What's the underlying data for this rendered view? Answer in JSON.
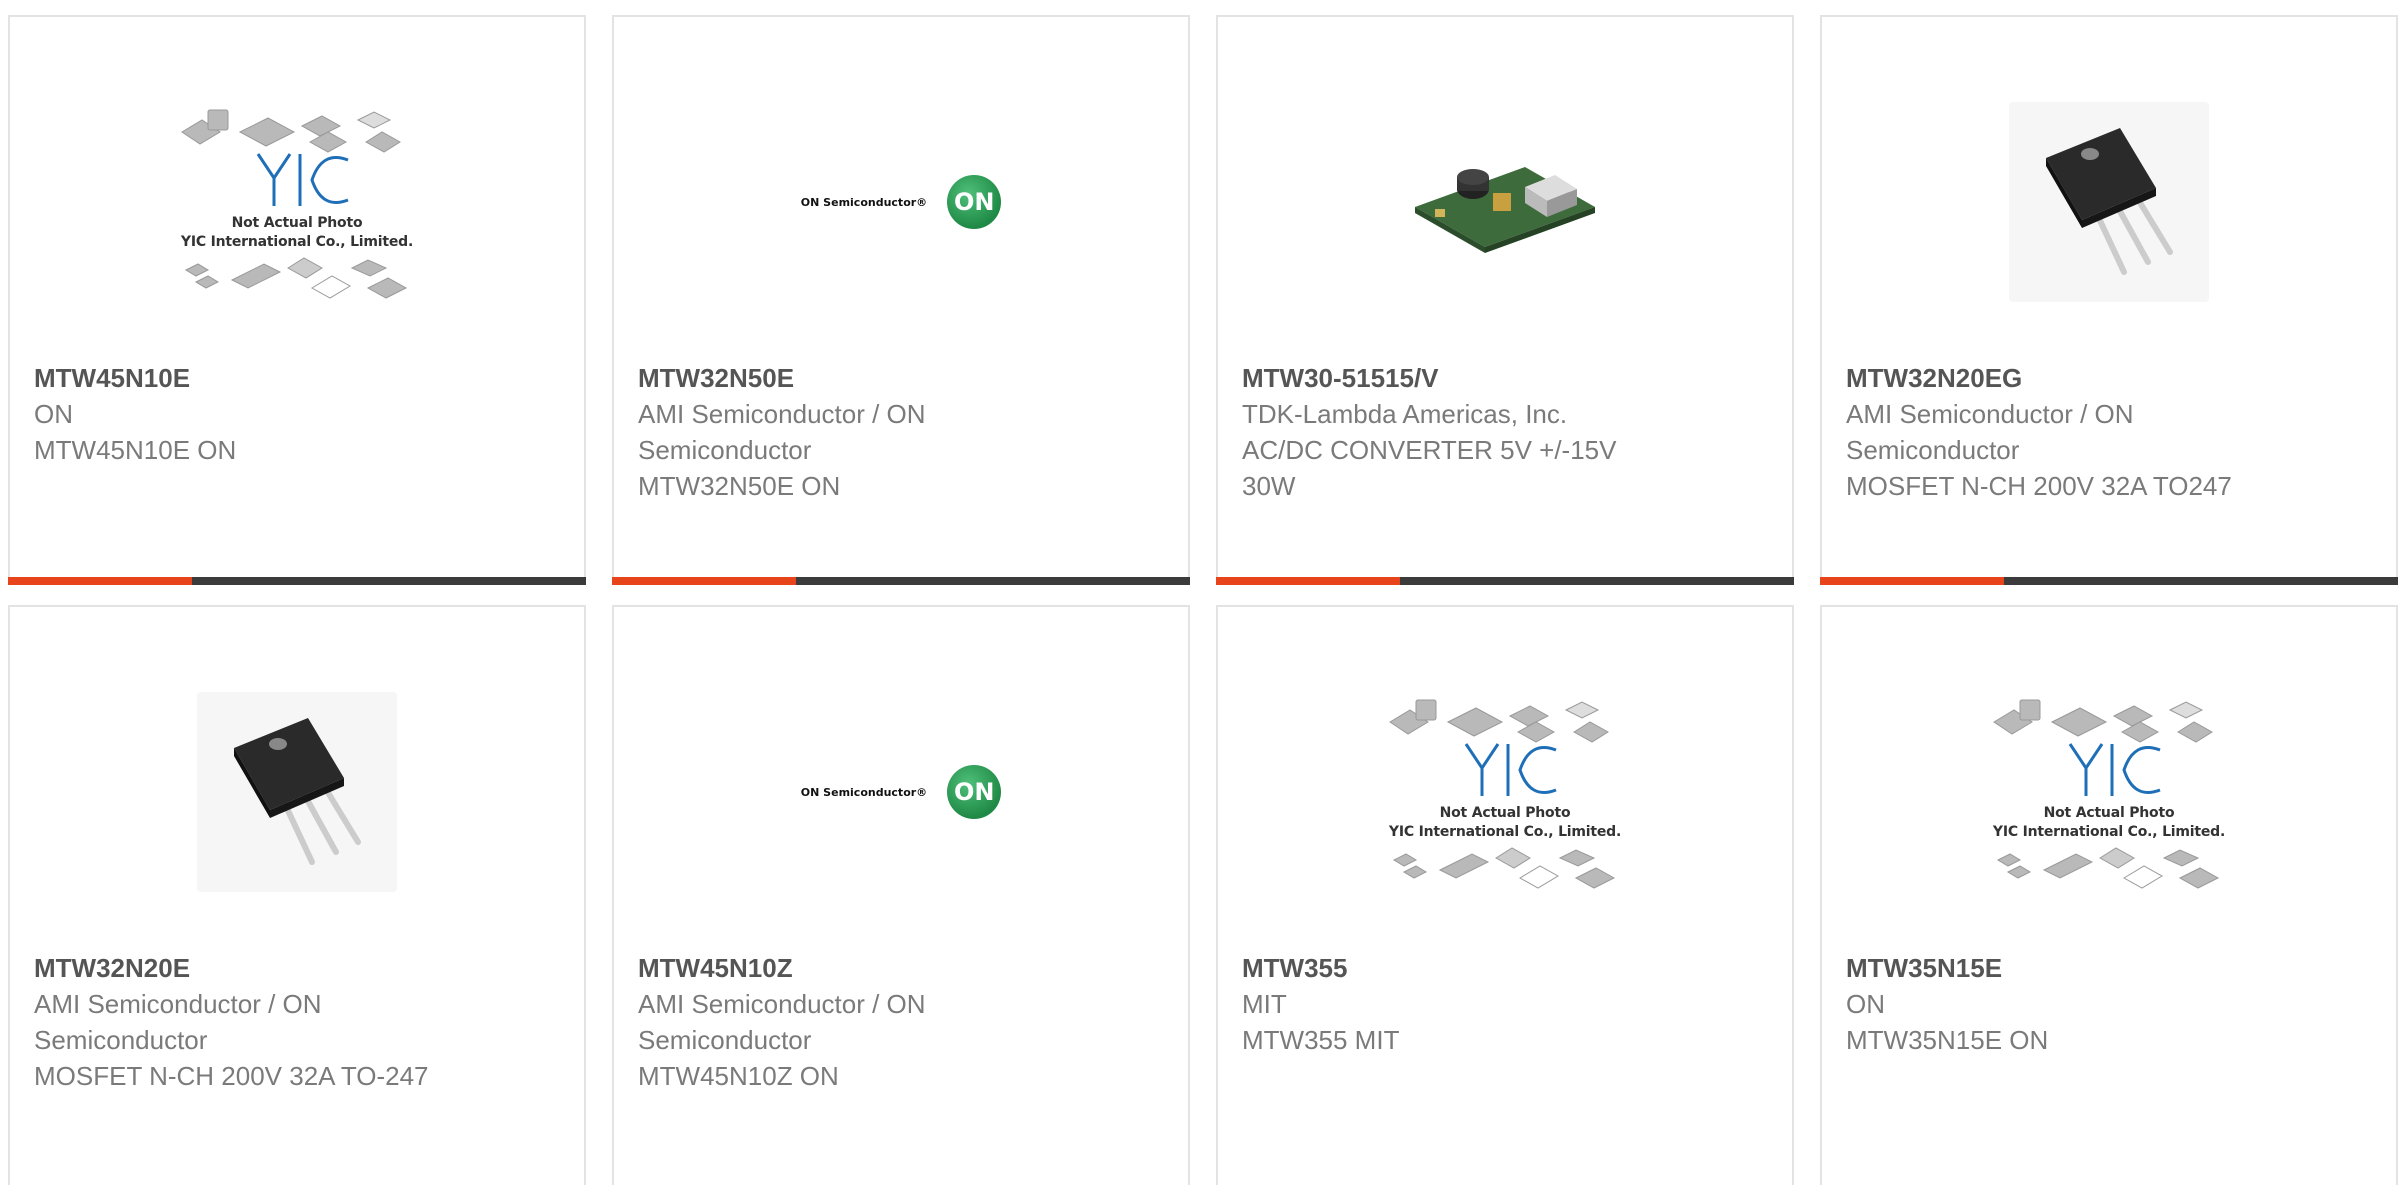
{
  "products": [
    {
      "part": "MTW45N10E",
      "manufacturer": "ON",
      "description": "MTW45N10E ON",
      "image": "placeholder-not-actual-photo",
      "caption_line1": "Not Actual Photo",
      "caption_line2": "YIC International Co., Limited."
    },
    {
      "part": "MTW32N50E",
      "manufacturer": "AMI Semiconductor / ON Semiconductor",
      "description": "MTW32N50E ON",
      "image": "on-semiconductor-logo",
      "logo_text": "ON Semiconductor®",
      "badge": "ON"
    },
    {
      "part": "MTW30-51515/V",
      "manufacturer": "TDK-Lambda Americas, Inc.",
      "description": "AC/DC CONVERTER 5V +/-15V 30W",
      "image": "power-supply-board-photo"
    },
    {
      "part": "MTW32N20EG",
      "manufacturer": "AMI Semiconductor / ON Semiconductor",
      "description": "MOSFET N-CH 200V 32A TO247",
      "image": "to247-transistor-photo"
    },
    {
      "part": "MTW32N20E",
      "manufacturer": "AMI Semiconductor / ON Semiconductor",
      "description": "MOSFET N-CH 200V 32A TO-247",
      "image": "to247-transistor-photo"
    },
    {
      "part": "MTW45N10Z",
      "manufacturer": "AMI Semiconductor / ON Semiconductor",
      "description": "MTW45N10Z ON",
      "image": "on-semiconductor-logo",
      "logo_text": "ON Semiconductor®",
      "badge": "ON"
    },
    {
      "part": "MTW355",
      "manufacturer": "MIT",
      "description": "MTW355 MIT",
      "image": "placeholder-not-actual-photo",
      "caption_line1": "Not Actual Photo",
      "caption_line2": "YIC International Co., Limited."
    },
    {
      "part": "MTW35N15E",
      "manufacturer": "ON",
      "description": "MTW35N15E ON",
      "image": "placeholder-not-actual-photo",
      "caption_line1": "Not Actual Photo",
      "caption_line2": "YIC International Co., Limited."
    }
  ],
  "colors": {
    "accent": "#e8441c",
    "bar": "#3b3b3b",
    "text_bold": "#555555",
    "text": "#7a7a7a"
  }
}
